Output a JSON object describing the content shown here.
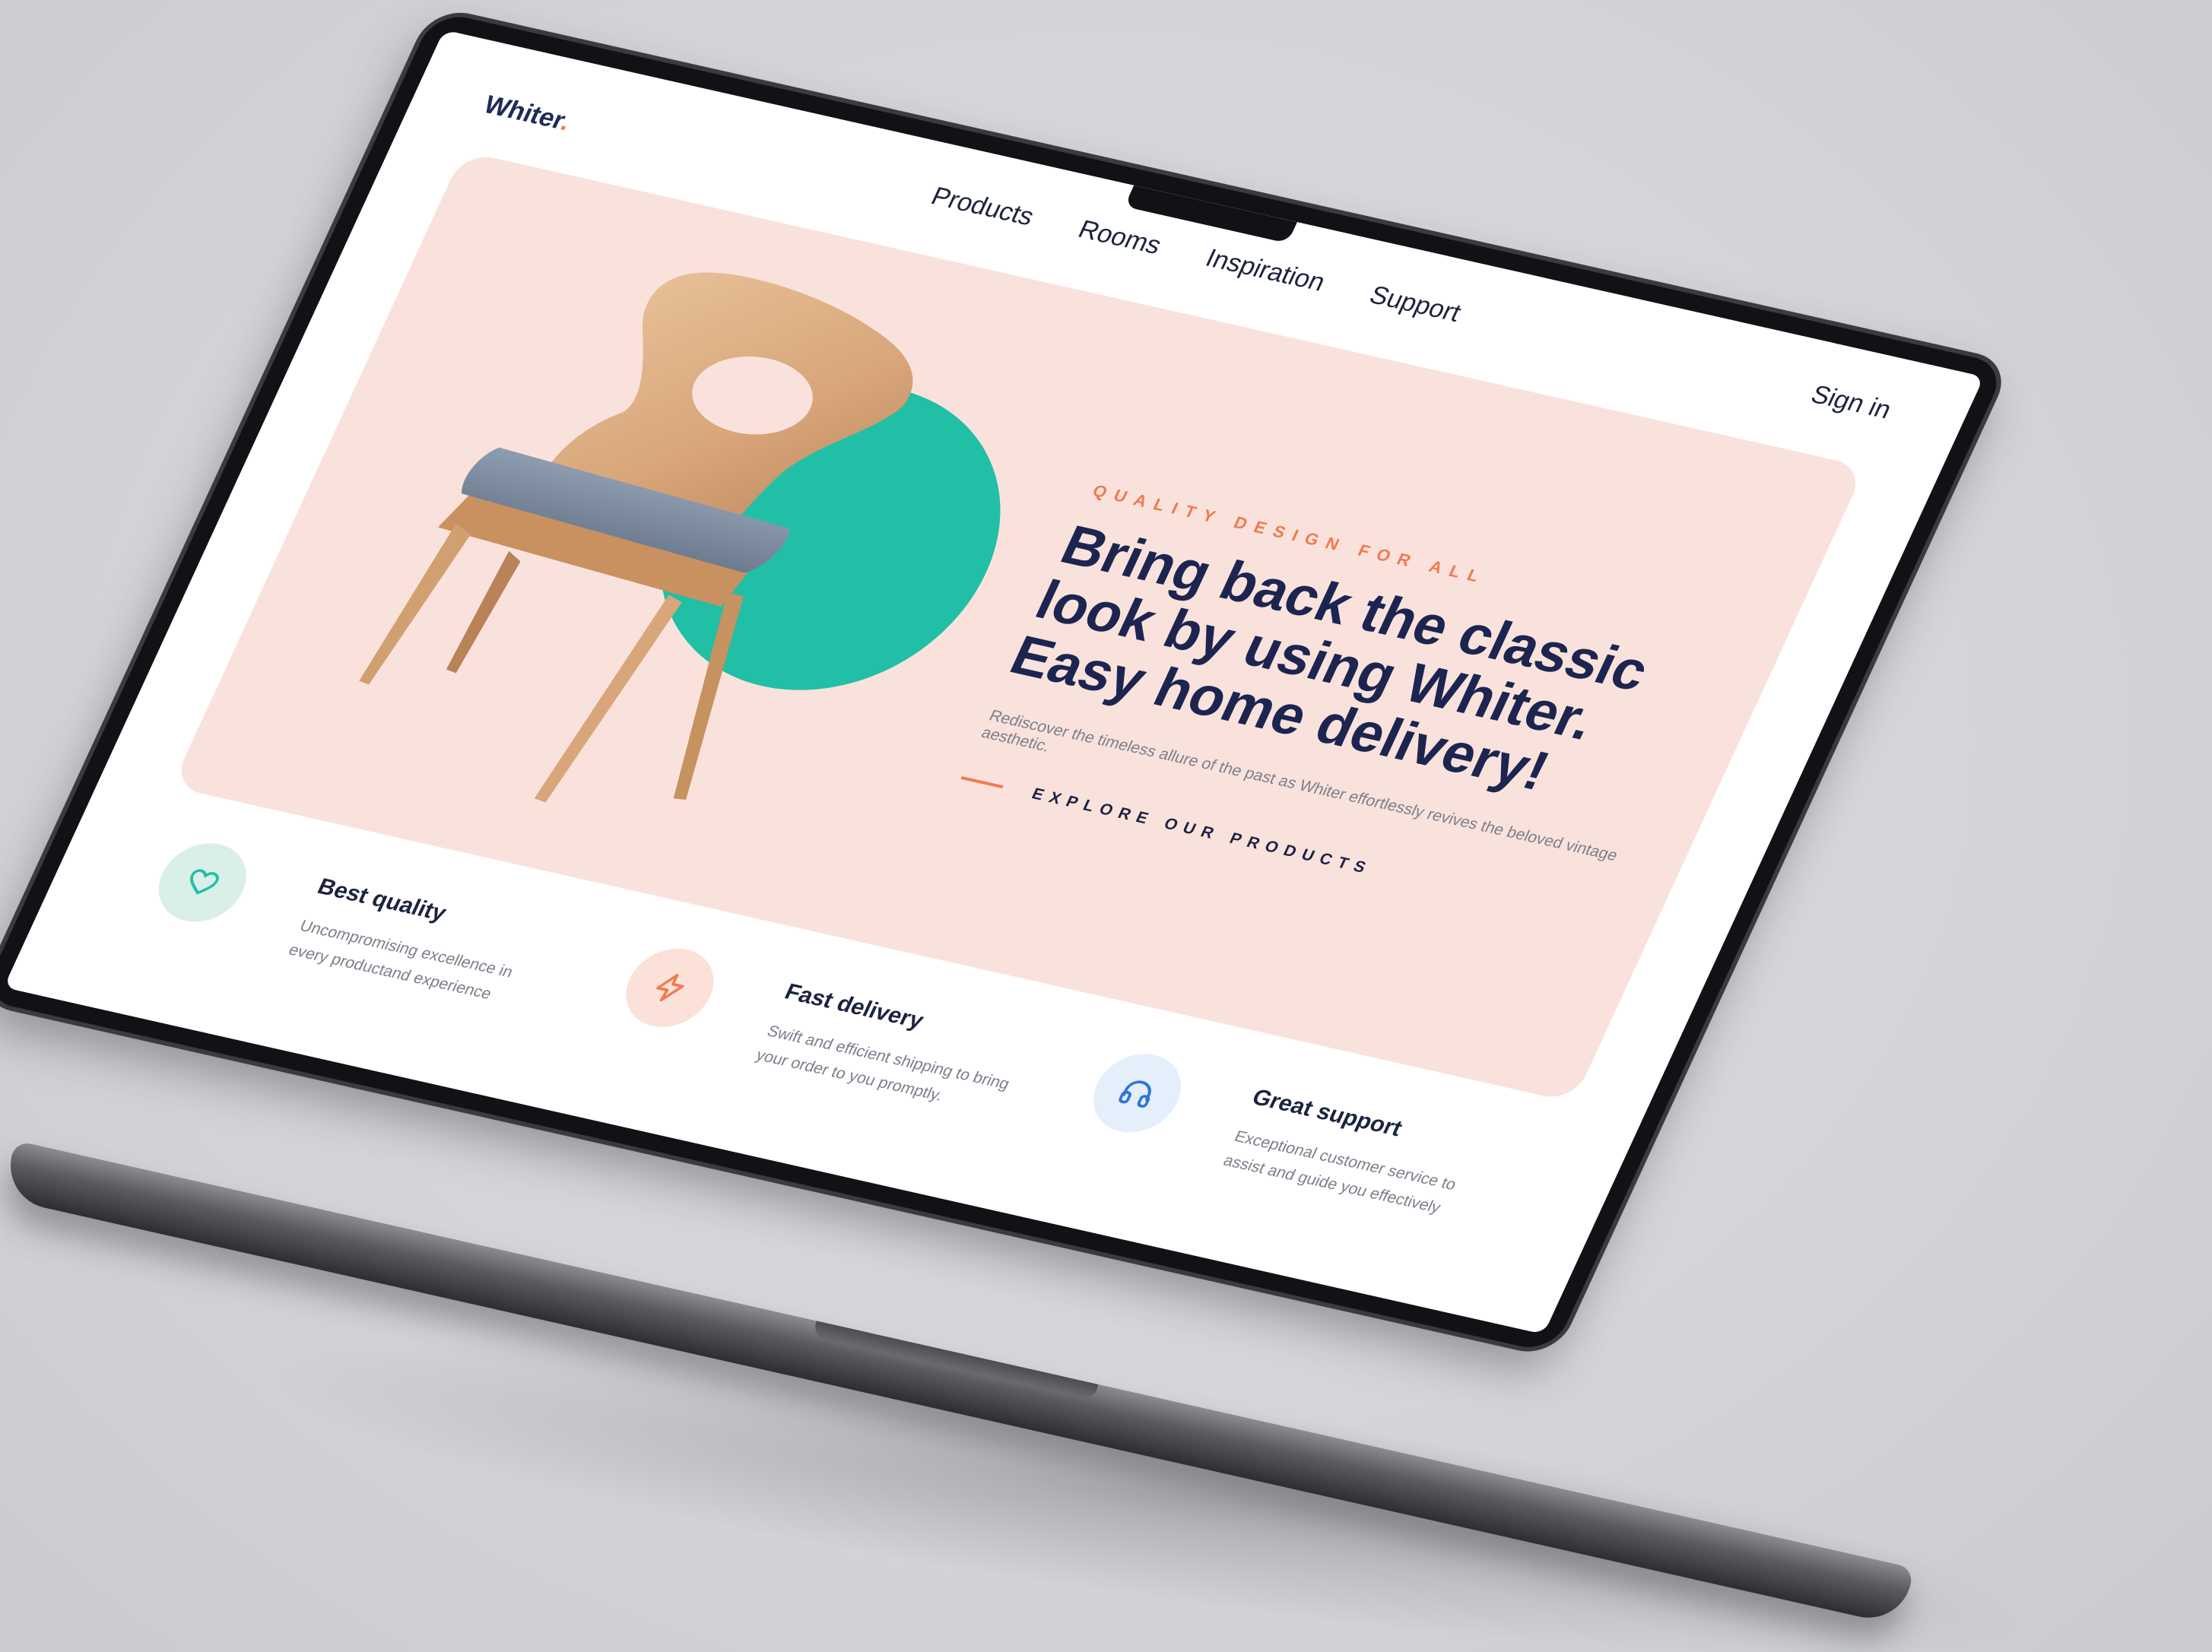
{
  "site": {
    "logo": "Whiter",
    "logo_dot": ".",
    "accent": "#f2794e",
    "brand": "#1f2b55"
  },
  "nav": {
    "items": [
      "Products",
      "Rooms",
      "Inspiration",
      "Support"
    ],
    "signin": "Sign in"
  },
  "hero": {
    "eyebrow": "QUALITY DESIGN FOR ALL",
    "headline": "Bring back the classic look by using Whiter. Easy home delivery!",
    "subtext": "Rediscover the timeless allure of the past as Whiter effortlessly revives the beloved vintage aesthetic.",
    "cta": "EXPLORE OUR PRODUCTS",
    "bg_color": "#fae2dc",
    "circle_color": "#22bfa7"
  },
  "features": [
    {
      "title": "Best quality",
      "text": "Uncompromising excellence in every productand experience",
      "icon": "heart-icon",
      "icon_bg": "#d9efe8",
      "icon_color": "#22bfa7"
    },
    {
      "title": "Fast delivery",
      "text": "Swift and efficient shipping to bring your order to you promptly.",
      "icon": "lightning-icon",
      "icon_bg": "#fbe1d8",
      "icon_color": "#f2794e"
    },
    {
      "title": "Great support",
      "text": "Exceptional customer service to assist and guide you effectively",
      "icon": "headphones-icon",
      "icon_bg": "#e4effb",
      "icon_color": "#2f76d6"
    }
  ]
}
